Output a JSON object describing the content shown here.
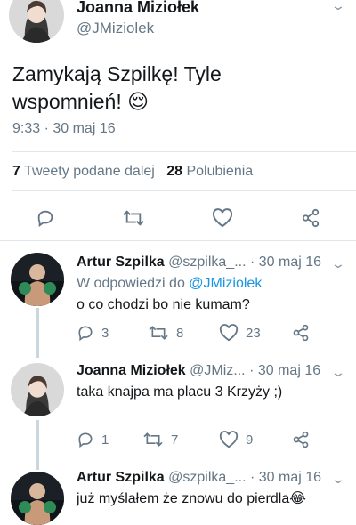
{
  "main_tweet": {
    "author_name": "Joanna Miziołek",
    "author_handle": "@JMiziolek",
    "text_line1": "Zamykają Szpilkę! Tyle",
    "text_line2": "wspomnień! 😌",
    "timestamp": "9:33 · 30 maj 16",
    "retweets_count": "7",
    "retweets_label": "Tweety podane dalej",
    "likes_count": "28",
    "likes_label": "Polubienia"
  },
  "replies": [
    {
      "author_name": "Artur Szpilka",
      "author_handle": "@szpilka_...",
      "time": "· 30 maj 16",
      "reply_to_label": "W odpowiedzi do",
      "reply_to_handle": "@JMiziolek",
      "text": "o co chodzi bo nie kumam?",
      "reply_count": "3",
      "retweet_count": "8",
      "like_count": "23"
    },
    {
      "author_name": "Joanna Miziołek",
      "author_handle": "@JMiz...",
      "time": "· 30 maj 16",
      "text": "taka knajpa ma placu 3 Krzyży ;)",
      "reply_count": "1",
      "retweet_count": "7",
      "like_count": "9"
    },
    {
      "author_name": "Artur Szpilka",
      "author_handle": "@szpilka_...",
      "time": "· 30 maj 16",
      "text": "już myślałem że znowu do pierdla😂"
    }
  ],
  "colors": {
    "link": "#1b95e0",
    "muted": "#657786",
    "divider": "#e1e8ed",
    "thread_line": "#ccd6dd"
  }
}
